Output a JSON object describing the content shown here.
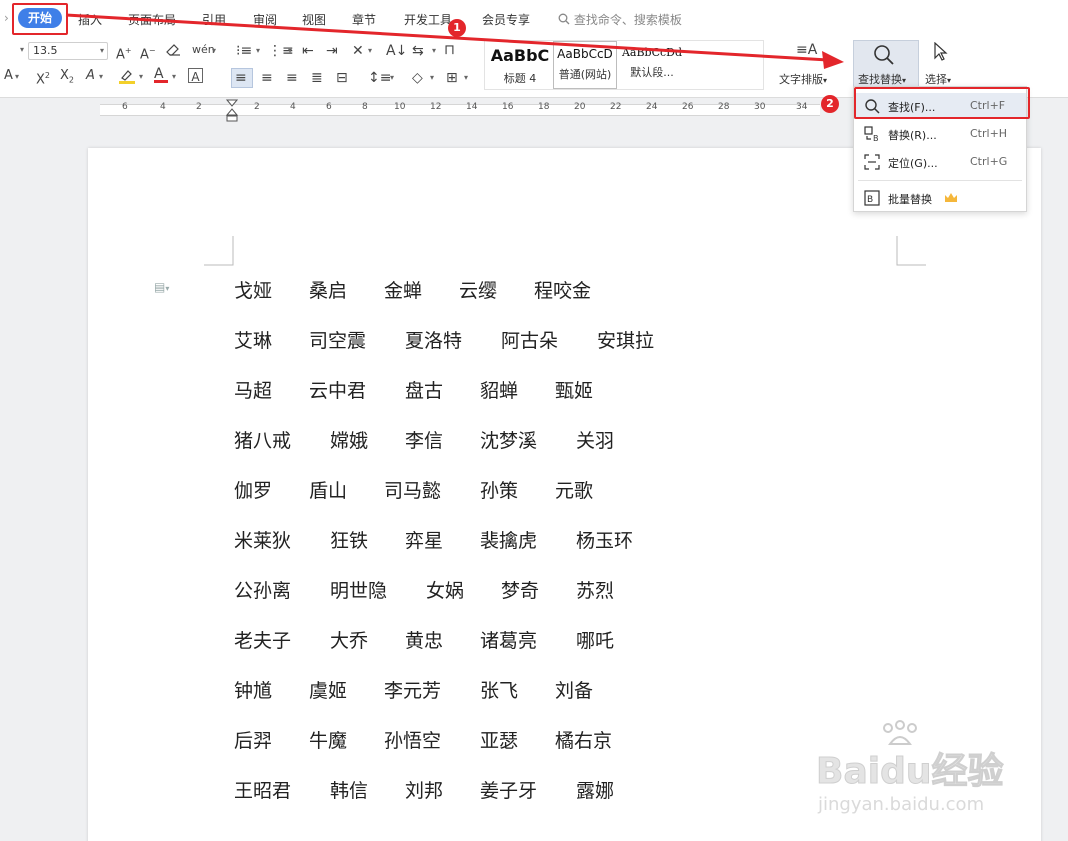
{
  "menu": {
    "items": [
      "开始",
      "插入",
      "页面布局",
      "引用",
      "审阅",
      "视图",
      "章节",
      "开发工具",
      "会员专享"
    ],
    "search_placeholder": "查找命令、搜索模板"
  },
  "ribbon": {
    "font_size": "13.5",
    "styles": [
      {
        "sample": "AaBbC",
        "name": "标题 4"
      },
      {
        "sample": "AaBbCcD",
        "name": "普通(网站)"
      },
      {
        "sample": "AaBbCcDd",
        "name": "默认段..."
      }
    ],
    "text_layout_label": "文字排版",
    "find_replace_label": "查找替换",
    "select_label": "选择"
  },
  "ruler": {
    "numbers": [
      "6",
      "4",
      "2",
      "2",
      "4",
      "6",
      "8",
      "10",
      "12",
      "14",
      "16",
      "18",
      "20",
      "22",
      "24",
      "26",
      "28",
      "30",
      "32",
      "34"
    ]
  },
  "dropdown": {
    "items": [
      {
        "label": "查找(F)...",
        "shortcut": "Ctrl+F"
      },
      {
        "label": "替换(R)...",
        "shortcut": "Ctrl+H"
      },
      {
        "label": "定位(G)...",
        "shortcut": "Ctrl+G"
      },
      {
        "label": "批量替换",
        "shortcut": ""
      }
    ]
  },
  "annotations": {
    "badge1": "1",
    "badge2": "2"
  },
  "document": {
    "lines": [
      [
        "戈娅",
        "桑启",
        "金蝉",
        "云缨",
        "程咬金"
      ],
      [
        "艾琳",
        "司空震",
        "夏洛特",
        "阿古朵",
        "安琪拉"
      ],
      [
        "马超",
        "云中君",
        "盘古",
        "貂蝉",
        "甄姬"
      ],
      [
        "猪八戒",
        "嫦娥",
        "李信",
        "沈梦溪",
        "关羽"
      ],
      [
        "伽罗",
        "盾山",
        "司马懿",
        "孙策",
        "元歌"
      ],
      [
        "米莱狄",
        "狂铁",
        "弈星",
        "裴擒虎",
        "杨玉环"
      ],
      [
        "公孙离",
        "明世隐",
        "女娲",
        "梦奇",
        "苏烈"
      ],
      [
        "老夫子",
        "大乔",
        "黄忠",
        "诸葛亮",
        "哪吒"
      ],
      [
        "钟馗",
        "虞姬",
        "李元芳",
        "张飞",
        "刘备"
      ],
      [
        "后羿",
        "牛魔",
        "孙悟空",
        "亚瑟",
        "橘右京"
      ],
      [
        "王昭君",
        "韩信",
        "刘邦",
        "姜子牙",
        "露娜"
      ]
    ]
  },
  "watermark": {
    "brand": "Baidu经验",
    "url": "jingyan.baidu.com"
  },
  "colors": {
    "accent": "#3f7fe8",
    "annotation_red": "#e3262b",
    "highlight_yellow": "#f3d02a",
    "font_color_red": "#e3262b"
  }
}
